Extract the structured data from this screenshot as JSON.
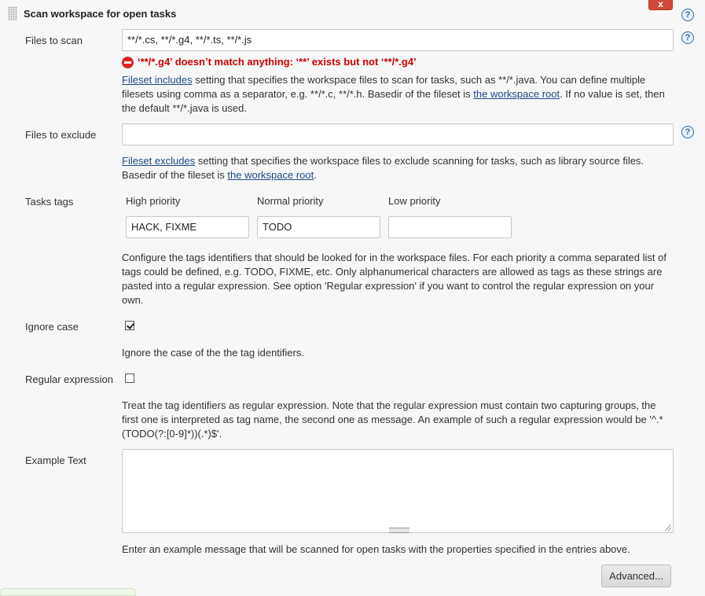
{
  "section": {
    "title": "Scan workspace for open tasks",
    "delete_label": "x",
    "help_glyph": "?"
  },
  "files_to_scan": {
    "label": "Files to scan",
    "value": "**/*.cs, **/*.g4, **/*.ts, **/*.js",
    "error": "‘**/*.g4’ doesn’t match anything: ‘**’ exists but not ‘**/*.g4’",
    "desc_link1": "Fileset includes",
    "desc_part1": " setting that specifies the workspace files to scan for tasks, such as **/*.java. You can define multiple filesets using comma as a separator, e.g. **/*.c, **/*.h. Basedir of the fileset is ",
    "desc_link2": "the workspace root",
    "desc_part2": ". If no value is set, then the default **/*.java is used."
  },
  "files_to_exclude": {
    "label": "Files to exclude",
    "value": "",
    "desc_link1": "Fileset excludes",
    "desc_part1": " setting that specifies the workspace files to exclude scanning for tasks, such as library source files. Basedir of the fileset is ",
    "desc_link2": "the workspace root",
    "desc_part2": "."
  },
  "tasks_tags": {
    "label": "Tasks tags",
    "high_label": "High priority",
    "normal_label": "Normal priority",
    "low_label": "Low priority",
    "high_value": "HACK, FIXME",
    "normal_value": "TODO",
    "low_value": "",
    "desc": "Configure the tags identifiers that should be looked for in the workspace files. For each priority a comma separated list of tags could be defined, e.g. TODO, FIXME, etc. Only alphanumerical characters are allowed as tags as these strings are pasted into a regular expression. See option 'Regular expression' if you want to control the regular expression on your own."
  },
  "ignore_case": {
    "label": "Ignore case",
    "checked": true,
    "desc": "Ignore the case of the the tag identifiers."
  },
  "regular_expression": {
    "label": "Regular expression",
    "checked": false,
    "desc": "Treat the tag identifiers as regular expression. Note that the regular expression must contain two capturing groups, the first one is interpreted as tag name, the second one as message. An example of such a regular expression would be '^.*(TODO(?:[0-9]*))(.*)$'."
  },
  "example_text": {
    "label": "Example Text",
    "value": "",
    "desc": "Enter an example message that will be scanned for open tasks with the properties specified in the entries above."
  },
  "advanced_label": "Advanced...",
  "icons": [
    "drag-handle-icon",
    "help-icon",
    "error-icon",
    "checkbox-checked-icon",
    "resize-grip-icon"
  ],
  "colors": {
    "error": "#cc0000",
    "link": "#204a87",
    "delete": "#d24939",
    "help": "#2e6ca6"
  }
}
